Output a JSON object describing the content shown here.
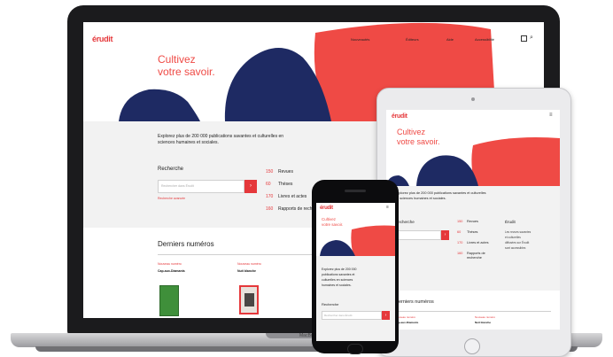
{
  "brand": "érudit",
  "colors": {
    "accent": "#e5383b",
    "navy": "#1e2a63",
    "coral": "#ef4a45"
  },
  "laptop": {
    "nav": [
      "Nouveautés",
      "Éditeurs",
      "Aide",
      "Accessibilité"
    ],
    "hero_title": [
      "Cultivez",
      "votre savoir."
    ],
    "intro": [
      "Explorez plus de 200 000 publications savantes et culturelles en",
      "sciences humaines et sociales."
    ],
    "search_label": "Recherche",
    "search_placeholder": "Rechercher dans Érudit",
    "search_link": "Recherche avancée",
    "categories": [
      {
        "num": "150",
        "label": "Revues"
      },
      {
        "num": "60",
        "label": "Thèses"
      },
      {
        "num": "170",
        "label": "Livres et actes"
      },
      {
        "num": "160",
        "label": "Rapports de recherche"
      }
    ],
    "latest_title": "Derniers numéros",
    "latest": [
      {
        "tag": "Nouveau numéro",
        "name": "Cap-aux-Diamants"
      },
      {
        "tag": "Nouveau numéro",
        "name": "Nuit blanche"
      }
    ],
    "brand_label": "MacBook"
  },
  "tablet": {
    "hero_title": [
      "Cultivez",
      "votre savoir."
    ],
    "intro": [
      "Explorez plus de 200 000 publications savantes et culturelles",
      "en sciences humaines et sociales."
    ],
    "search_label": "Recherche",
    "categories": [
      {
        "num": "150",
        "label": "Revues"
      },
      {
        "num": "60",
        "label": "Thèses"
      },
      {
        "num": "170",
        "label": "Livres et actes"
      },
      {
        "num": "160",
        "label": "Rapports de recherche"
      }
    ],
    "side_title": "Érudit",
    "side_text": [
      "Les revues savantes",
      "et culturelles",
      "diffusées sur Érudit",
      "sont accessibles"
    ],
    "latest_title": "Derniers numéros",
    "latest_tags": [
      "Nouveau numéro",
      "Nouveau numéro"
    ],
    "latest_names": [
      "Cap-aux-Diamants",
      "Nuit blanche"
    ]
  },
  "phone": {
    "hero_title": [
      "Cultivez",
      "votre savoir."
    ],
    "intro": [
      "Explorez plus de 200 000",
      "publications savantes et",
      "culturelles en sciences",
      "humaines et sociales."
    ],
    "search_label": "Recherche",
    "search_placeholder": "Rechercher dans Érudit"
  }
}
